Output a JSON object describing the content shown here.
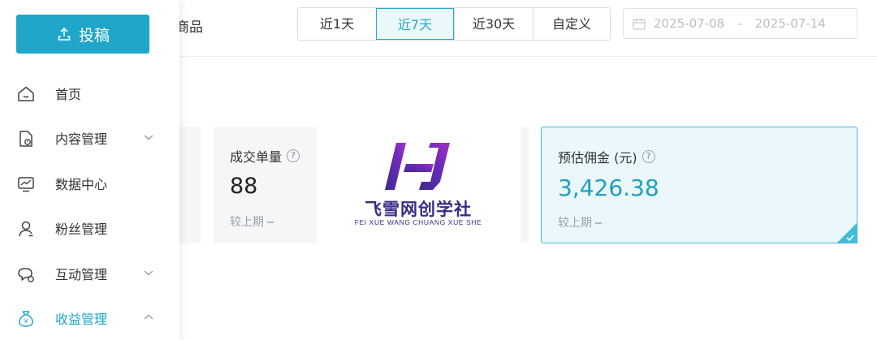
{
  "sidebar": {
    "publish_label": "投稿",
    "items": [
      {
        "label": "首页",
        "icon": "home-icon",
        "expandable": false
      },
      {
        "label": "内容管理",
        "icon": "document-icon",
        "expandable": true,
        "expanded": false
      },
      {
        "label": "数据中心",
        "icon": "chart-monitor-icon",
        "expandable": false
      },
      {
        "label": "粉丝管理",
        "icon": "user-icon",
        "expandable": false
      },
      {
        "label": "互动管理",
        "icon": "chat-icon",
        "expandable": true,
        "expanded": false
      },
      {
        "label": "收益管理",
        "icon": "money-bag-icon",
        "expandable": true,
        "expanded": true,
        "active": true
      }
    ],
    "accent_color": "#1fa6c9"
  },
  "header": {
    "tab_partial": "商品",
    "range_options": [
      "近1天",
      "近7天",
      "近30天",
      "自定义"
    ],
    "selected_range": "近7天",
    "date_start": "2025-07-08",
    "date_separator": "-",
    "date_end": "2025-07-14"
  },
  "stats": {
    "orders": {
      "label": "成交单量",
      "value": "88",
      "compare": "较上期"
    },
    "commission": {
      "label": "预估佣金 (元)",
      "value": "3,426.38",
      "compare": "较上期",
      "selected": true
    }
  },
  "watermark": {
    "brand_cn": "飞雪网创学社",
    "brand_en": "FEI XUE WANG CHUANG XUE SHE"
  }
}
